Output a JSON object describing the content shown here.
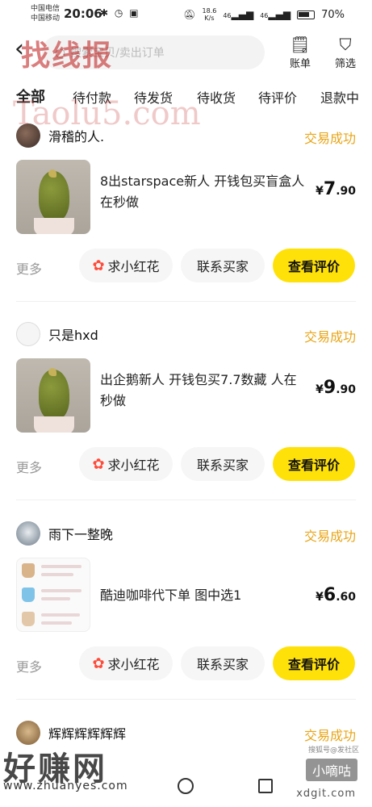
{
  "status_bar": {
    "carrier_1": "中国电信",
    "carrier_2": "中国移动",
    "time": "20:06",
    "speed_value": "18.6",
    "speed_unit": "K/s",
    "signal_1": "46",
    "signal_2": "46",
    "battery": "70%"
  },
  "header": {
    "search_placeholder": "搜索宝贝/卖出订单",
    "bill_label": "账单",
    "filter_label": "筛选"
  },
  "tabs": [
    "全部",
    "待付款",
    "待发货",
    "待收货",
    "待评价",
    "退款中"
  ],
  "orders": [
    {
      "seller": "滑稽的人.",
      "status": "交易成功",
      "title": "8出starspace新人 开钱包买盲盒人在秒做",
      "price_symbol": "¥",
      "price_int": "7",
      "price_dec": ".90",
      "more": "更多",
      "flower": "求小红花",
      "contact": "联系买家",
      "review": "查看评价"
    },
    {
      "seller": "只是hxd",
      "status": "交易成功",
      "title": "出企鹅新人 开钱包买7.7数藏 人在秒做",
      "price_symbol": "¥",
      "price_int": "9",
      "price_dec": ".90",
      "more": "更多",
      "flower": "求小红花",
      "contact": "联系买家",
      "review": "查看评价"
    },
    {
      "seller": "雨下一整晚",
      "status": "交易成功",
      "title": "酷迪咖啡代下单 图中选1",
      "price_symbol": "¥",
      "price_int": "6",
      "price_dec": ".60",
      "more": "更多",
      "flower": "求小红花",
      "contact": "联系买家",
      "review": "查看评价"
    },
    {
      "seller": "辉辉辉辉辉辉",
      "status": "交易成功"
    }
  ],
  "watermarks": {
    "top": "找线报",
    "top_url": "Taolu5.com",
    "bottom": "好赚网",
    "bottom_url": "www.zhuanyes.com",
    "badge": "小嘀咕",
    "badge_url": "xdgit.com",
    "badge_small": "搜狐号@发社区"
  }
}
